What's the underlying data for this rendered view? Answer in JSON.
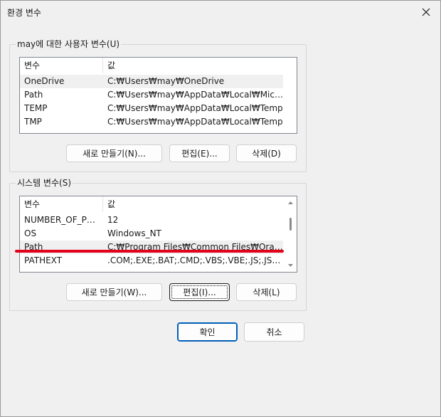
{
  "window": {
    "title": "환경 변수"
  },
  "user_vars": {
    "group_label": "may에 대한 사용자 변수(U)",
    "columns": [
      "변수",
      "값"
    ],
    "rows": [
      {
        "name": "OneDrive",
        "value": "C:₩Users₩may₩OneDrive",
        "selected": true
      },
      {
        "name": "Path",
        "value": "C:₩Users₩may₩AppData₩Local₩Microsoft...",
        "selected": false
      },
      {
        "name": "TEMP",
        "value": "C:₩Users₩may₩AppData₩Local₩Temp",
        "selected": false
      },
      {
        "name": "TMP",
        "value": "C:₩Users₩may₩AppData₩Local₩Temp",
        "selected": false
      }
    ],
    "buttons": {
      "new": "새로 만들기(N)...",
      "edit": "편집(E)...",
      "delete": "삭제(D)"
    }
  },
  "system_vars": {
    "group_label": "시스템 변수(S)",
    "columns": [
      "변수",
      "값"
    ],
    "rows": [
      {
        "name": "NUMBER_OF_PRO...",
        "value": "12",
        "selected": false
      },
      {
        "name": "OS",
        "value": "Windows_NT",
        "selected": false
      },
      {
        "name": "Path",
        "value": "C:₩Program Files₩Common Files₩Oracle₩...",
        "selected": true
      },
      {
        "name": "PATHEXT",
        "value": ".COM;.EXE;.BAT;.CMD;.VBS;.VBE;.JS;.JSE;.W...",
        "selected": false
      }
    ],
    "buttons": {
      "new": "새로 만들기(W)...",
      "edit": "편집(I)...",
      "delete": "삭제(L)"
    }
  },
  "dialog_buttons": {
    "ok": "확인",
    "cancel": "취소"
  },
  "colors": {
    "highlight_underline": "#e3001b",
    "primary_border": "#005fb8"
  }
}
